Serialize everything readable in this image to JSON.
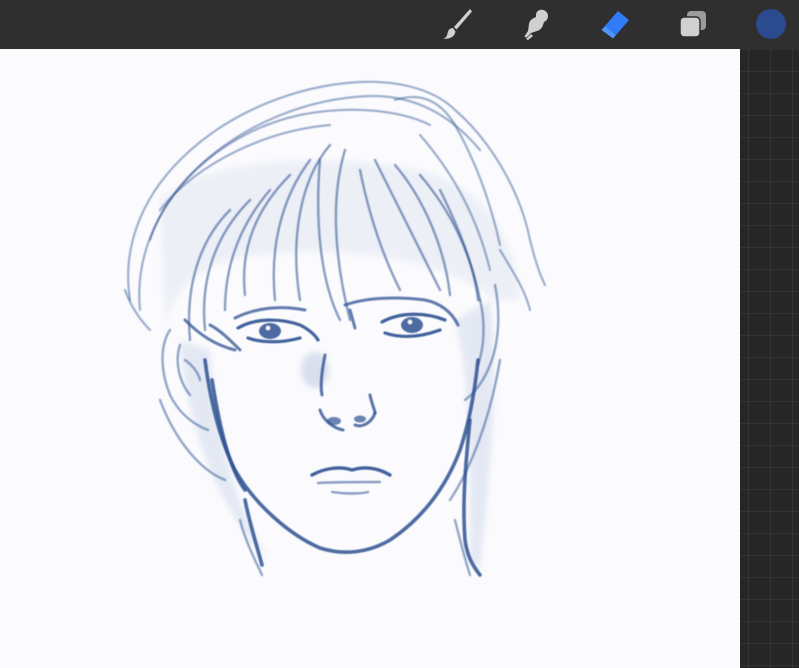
{
  "toolbar": {
    "tools": [
      {
        "id": "brush",
        "icon": "brush-icon"
      },
      {
        "id": "smudge",
        "icon": "smudge-icon"
      },
      {
        "id": "eraser",
        "icon": "eraser-icon",
        "active": true
      },
      {
        "id": "layers",
        "icon": "layers-icon"
      }
    ],
    "current_color": "#2a4b8d"
  },
  "colors": {
    "toolbar_bg": "#2f2f2f",
    "canvas_bg": "#fbfbfd",
    "workspace_bg": "#262626",
    "icon_inactive": "#d0d0d0",
    "icon_active": "#2f7cf6",
    "ink": "#2e5192"
  },
  "canvas": {
    "content": "pencil-sketch-portrait"
  }
}
